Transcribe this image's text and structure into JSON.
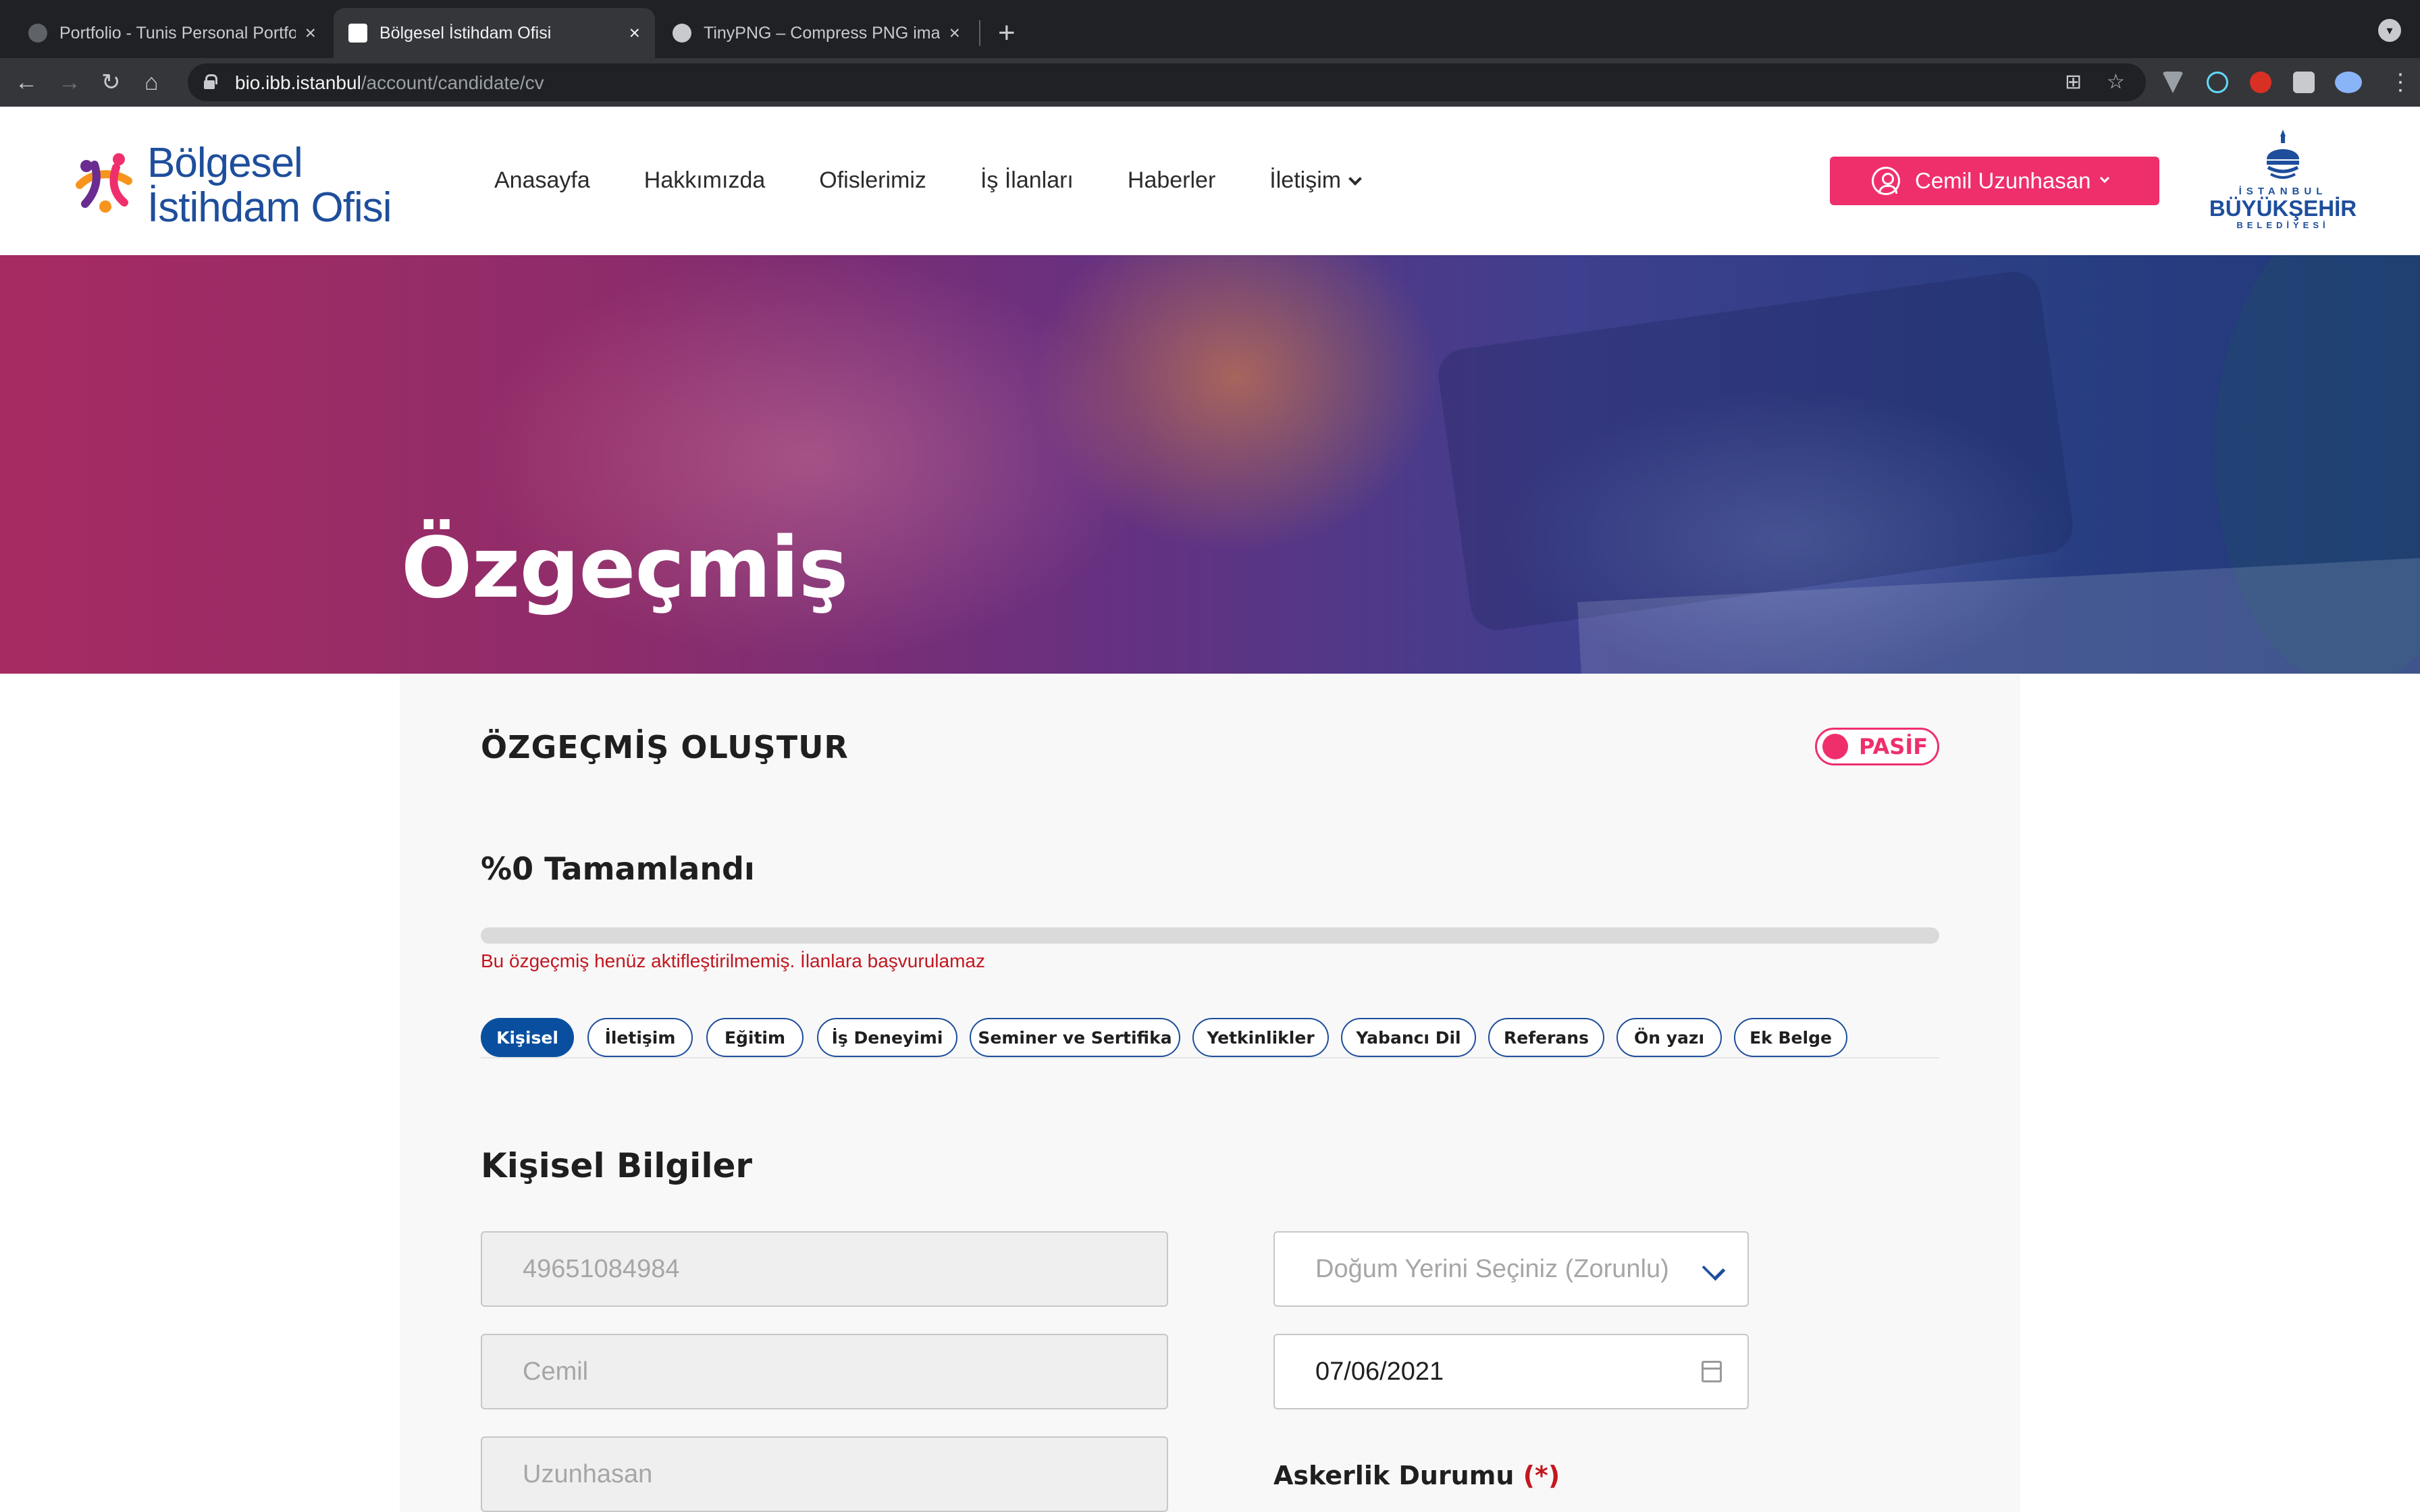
{
  "browser": {
    "tabs": [
      {
        "title": "Portfolio - Tunis Personal Portfo",
        "active": false
      },
      {
        "title": "Bölgesel İstihdam Ofisi",
        "active": true
      },
      {
        "title": "TinyPNG – Compress PNG ima",
        "active": false
      }
    ],
    "new_tab_label": "+",
    "url_host": "bio.ibb.istanbul",
    "url_path": "/account/candidate/cv"
  },
  "header": {
    "logo_line1": "Bölgesel",
    "logo_line2": "İstihdam Ofisi",
    "nav": [
      "Anasayfa",
      "Hakkımızda",
      "Ofislerimiz",
      "İş İlanları",
      "Haberler",
      "İletişim"
    ],
    "user_name": "Cemil Uzunhasan",
    "ibb_line1": "İSTANBUL",
    "ibb_line2": "BÜYÜKŞEHİR",
    "ibb_line3": "BELEDİYESİ"
  },
  "hero": {
    "title": "Özgeçmiş"
  },
  "cv": {
    "title": "ÖZGEÇMİŞ OLUŞTUR",
    "status": "PASİF",
    "progress_label": "%0 Tamamlandı",
    "progress_percent": 0,
    "warning": "Bu özgeçmiş henüz aktifleştirilmemiş. İlanlara başvurulamaz",
    "tabs": [
      "Kişisel",
      "İletişim",
      "Eğitim",
      "İş Deneyimi",
      "Seminer ve Sertifika",
      "Yetkinlikler",
      "Yabancı Dil",
      "Referans",
      "Ön yazı",
      "Ek Belge"
    ],
    "active_tab": "Kişisel",
    "section_title": "Kişisel Bilgiler",
    "fields": {
      "tc_no": "49651084984",
      "first_name": "Cemil",
      "last_name": "Uzunhasan",
      "birthplace_placeholder": "Doğum Yerini Seçiniz (Zorunlu)",
      "birth_date": "07/06/2021"
    },
    "military_label": "Askerlik Durumu",
    "required_mark": "(*)"
  },
  "colors": {
    "brand_blue": "#1e4e9c",
    "accent_pink": "#ef2f6c",
    "warning_red": "#c3171f"
  }
}
